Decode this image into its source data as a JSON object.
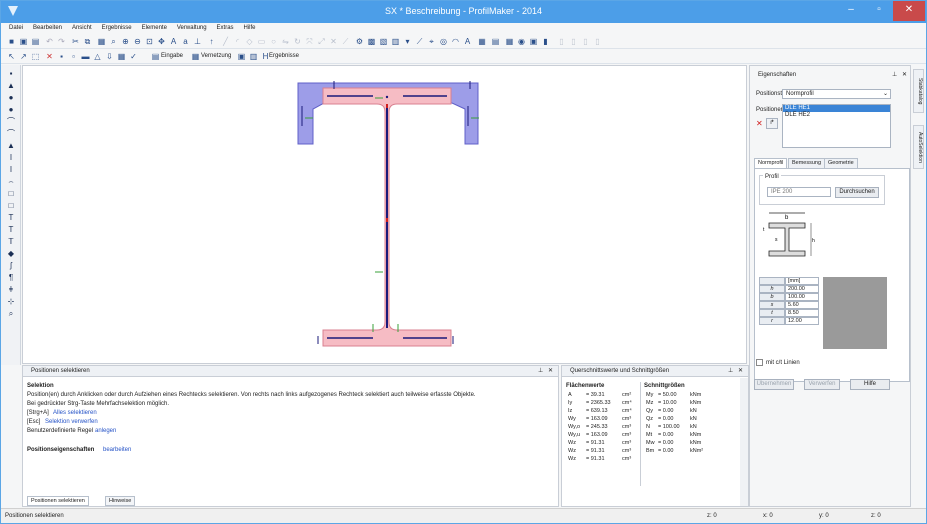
{
  "window": {
    "title": "SX * Beschreibung - ProfilMaker - 2014",
    "min_label": "–",
    "max_label": "▫",
    "close_label": "✕"
  },
  "menu": [
    "Datei",
    "Bearbeiten",
    "Ansicht",
    "Ergebnisse",
    "Elemente",
    "Verwaltung",
    "Extras",
    "Hilfe"
  ],
  "toolbar2": {
    "eingabe_label": "Eingabe",
    "vernetzung_label": "Vernetzung",
    "ergebnisse_label": "Ergebnisse"
  },
  "positions_panel": {
    "header": "Positionen selektieren",
    "heading": "Selektion",
    "line1": "Position(en) durch Anklicken oder durch Aufziehen eines Rechtecks selektieren. Von rechts nach links aufgezogenes Rechteck selektiert auch teilweise erfasste Objekte.",
    "line2": "Bei gedrückter Strg-Taste Mehrfachselektion möglich.",
    "line3_key": "[Strg+A]",
    "line3_link": "Alles selektieren",
    "line4_key": "[Esc]",
    "line4_link": "Selektion verwerfen",
    "line5_text": "Benutzerdefinierte Regel",
    "line5_link": "anlegen",
    "props_label": "Positionseigenschaften",
    "props_link": "bearbeiten",
    "tab1": "Positionen selektieren",
    "tab2": "Hinweise"
  },
  "section_panel": {
    "header": "Querschnittswerte und Schnittgrößen",
    "col1_title": "Flächenwerte",
    "col2_title": "Schnittgrößen",
    "flaechenwerte": [
      {
        "name": "A",
        "value": "= 39.31",
        "unit": "cm²"
      },
      {
        "name": "Iy",
        "value": "= 2365.33",
        "unit": "cm⁴"
      },
      {
        "name": "Iz",
        "value": "= 639.13",
        "unit": "cm⁴"
      },
      {
        "name": "Wy",
        "value": "= 163.09",
        "unit": "cm³"
      },
      {
        "name": "Wy,o",
        "value": "= 245.33",
        "unit": "cm³"
      },
      {
        "name": "Wy,u",
        "value": "= 163.09",
        "unit": "cm³"
      },
      {
        "name": "Wz",
        "value": "= 91.31",
        "unit": "cm³"
      },
      {
        "name": "Wz",
        "value": "= 91.31",
        "unit": "cm³"
      },
      {
        "name": "Wz",
        "value": "= 91.31",
        "unit": "cm³"
      }
    ],
    "schnittgroessen": [
      {
        "name": "My",
        "value": "= 50.00",
        "unit": "kNm"
      },
      {
        "name": "Mz",
        "value": "= 10.00",
        "unit": "kNm"
      },
      {
        "name": "Qy",
        "value": "= 0.00",
        "unit": "kN"
      },
      {
        "name": "Qz",
        "value": "= 0.00",
        "unit": "kN"
      },
      {
        "name": "N",
        "value": "= 100.00",
        "unit": "kN"
      },
      {
        "name": "Mt",
        "value": "= 0.00",
        "unit": "kNm"
      },
      {
        "name": "Mw",
        "value": "= 0.00",
        "unit": "kNm"
      },
      {
        "name": "Bm",
        "value": "= 0.00",
        "unit": "kNm²"
      }
    ]
  },
  "properties": {
    "header": "Eigenschaften",
    "positionstyp_label": "Positionstyp",
    "positionstyp_value": "Normprofil",
    "positionen_label": "Positionen",
    "positionen_list": [
      "DLE HE1",
      "DLE HE2"
    ],
    "tabs": [
      "Normprofil",
      "Bemessung",
      "Geometrie"
    ],
    "profil_label": "Profil",
    "profil_value": "IPE 200",
    "suchen_button": "Durchsuchen",
    "table_unit": "[mm]",
    "params": [
      {
        "name": "h",
        "value": "200.00"
      },
      {
        "name": "b",
        "value": "100.00"
      },
      {
        "name": "s",
        "value": "5.60"
      },
      {
        "name": "t",
        "value": "8.50"
      },
      {
        "name": "r",
        "value": "12.00"
      }
    ],
    "checkbox_label": "mit c/t Linien",
    "btn_uebernehmen": "Übernehmen",
    "btn_verwerfen": "Verwerfen",
    "btn_hilfe": "Hilfe"
  },
  "sidetabs": [
    "Stabkatalog",
    "AutoSelektion"
  ],
  "statusbar": {
    "text": "Positionen selektieren",
    "fields": [
      "z: 0",
      "x: 0",
      "y: 0",
      "z: 0"
    ]
  }
}
